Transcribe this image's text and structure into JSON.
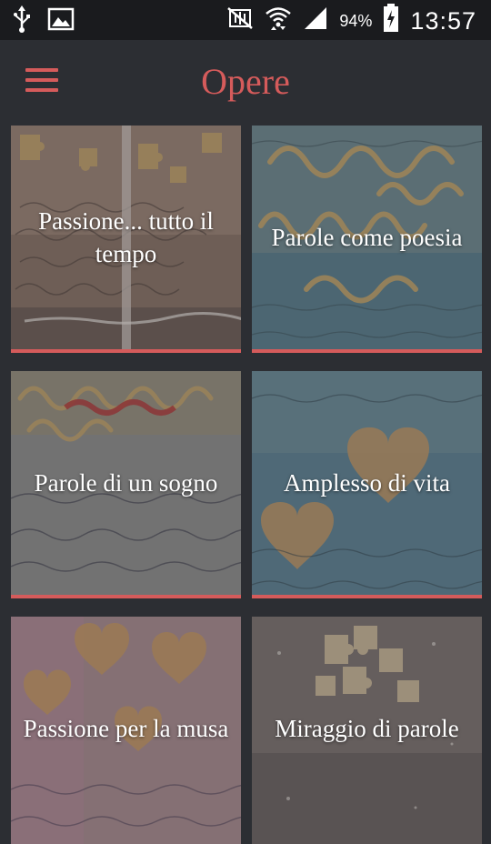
{
  "status_bar": {
    "battery_percent": "94%",
    "time": "13:57",
    "icons": [
      "usb-icon",
      "image-icon",
      "mute-icon",
      "wifi-icon",
      "signal-icon",
      "battery-charging-icon"
    ]
  },
  "app_bar": {
    "title": "Opere",
    "menu_icon": "hamburger-menu-icon"
  },
  "colors": {
    "accent": "#d55b5b",
    "background": "#2c2e33",
    "status_bar": "#1a1b1e"
  },
  "works": [
    {
      "title": "Passione... tutto il tempo"
    },
    {
      "title": "Parole come poesia"
    },
    {
      "title": "Parole di un sogno"
    },
    {
      "title": "Amplesso di vita"
    },
    {
      "title": "Passione per la musa"
    },
    {
      "title": "Miraggio di parole"
    }
  ]
}
